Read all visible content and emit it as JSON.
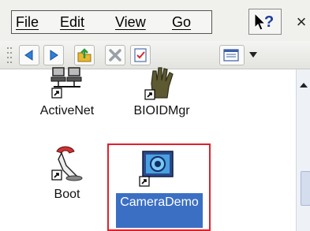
{
  "menubar": {
    "items": [
      {
        "label": "File"
      },
      {
        "label": "Edit"
      },
      {
        "label": "View"
      },
      {
        "label": "Go"
      }
    ],
    "help_icon": "help-question-icon",
    "close_label": "×"
  },
  "toolbar": {
    "buttons": [
      "back-arrow-icon",
      "forward-arrow-icon",
      "up-folder-icon",
      "delete-x-icon",
      "properties-icon",
      "view-mode-icon"
    ],
    "dropdown_icon": "dropdown-arrow-icon"
  },
  "files": [
    {
      "label": "ActiveNet",
      "icon": "network-computers-icon"
    },
    {
      "label": "BIOIDMgr",
      "icon": "hand-icon"
    },
    {
      "label": "Boot",
      "icon": "boot-icon"
    },
    {
      "label": "CameraDemo",
      "icon": "camera-icon",
      "selected": true
    }
  ],
  "colors": {
    "selection": "#3b6fc4",
    "highlight_frame": "#e0202a"
  }
}
